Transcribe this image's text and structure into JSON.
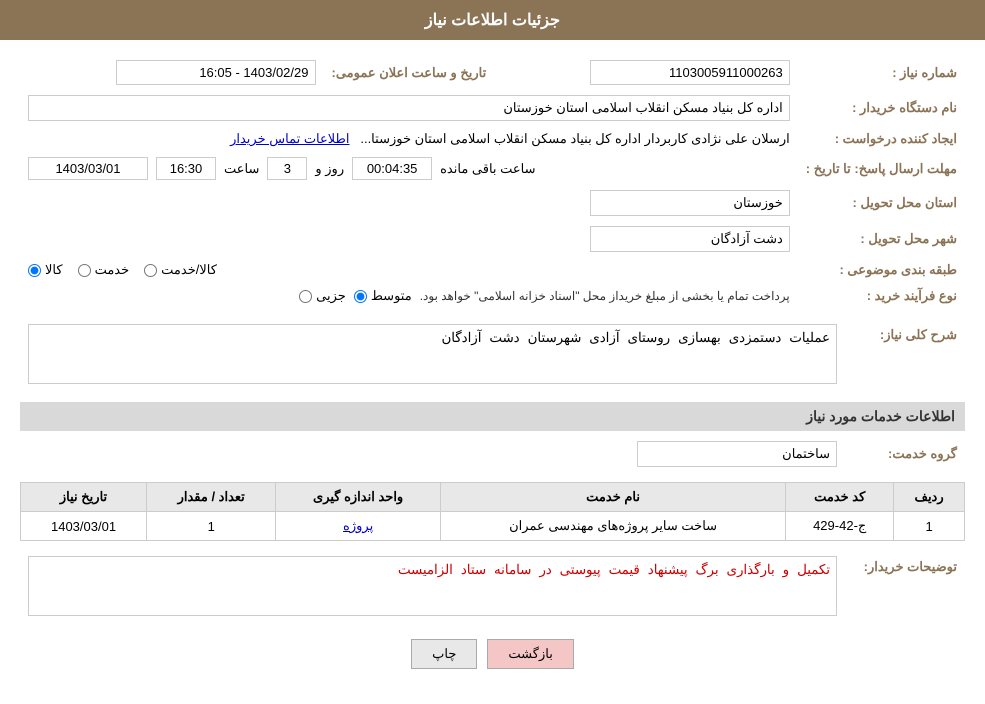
{
  "header": {
    "title": "جزئیات اطلاعات نیاز"
  },
  "fields": {
    "shomara_niaz_label": "شماره نیاز :",
    "shomara_niaz_value": "1103005911000263",
    "nam_dastgah_label": "نام دستگاه خریدار :",
    "nam_dastgah_value": "اداره کل بنیاد مسکن انقلاب اسلامی استان خوزستان",
    "ijad_label": "ایجاد کننده درخواست :",
    "ijad_value": "ارسلان علی نژادی کاربردار اداره کل بنیاد مسکن انقلاب اسلامی استان خوزستا...",
    "ijad_link": "اطلاعات تماس خریدار",
    "mohlat_label": "مهلت ارسال پاسخ: تا تاریخ :",
    "tarikh_label": "تاریخ و ساعت اعلان عمومی:",
    "tarikh_value": "1403/02/29 - 16:05",
    "date_value": "1403/03/01",
    "time_value": "16:30",
    "roz_value": "3",
    "countdown_value": "00:04:35",
    "ostan_label": "استان محل تحویل :",
    "ostan_value": "خوزستان",
    "shahr_label": "شهر محل تحویل :",
    "shahr_value": "دشت آزادگان",
    "tabaqe_label": "طبقه بندی موضوعی :",
    "tabaqe_options": [
      {
        "label": "کالا",
        "checked": true
      },
      {
        "label": "خدمت",
        "checked": false
      },
      {
        "label": "کالا/خدمت",
        "checked": false
      }
    ],
    "noeParvand_label": "نوع فرآیند خرید :",
    "noeParvand_options": [
      {
        "label": "جزیی",
        "checked": false
      },
      {
        "label": "متوسط",
        "checked": true
      }
    ],
    "noeParvand_note": "پرداخت تمام یا بخشی از مبلغ خریداز محل \"اسناد خزانه اسلامی\" خواهد بود.",
    "sharh_label": "شرح کلی نیاز:",
    "sharh_value": "عملیات دستمزدی بهسازی روستای آزادی شهرستان دشت آزادگان",
    "khadamat_label": "اطلاعات خدمات مورد نیاز",
    "grouh_label": "گروه خدمت:",
    "grouh_value": "ساختمان",
    "table": {
      "headers": [
        "ردیف",
        "کد خدمت",
        "نام خدمت",
        "واحد اندازه گیری",
        "تعداد / مقدار",
        "تاریخ نیاز"
      ],
      "rows": [
        {
          "radif": "1",
          "kod": "ج-42-429",
          "nam": "ساخت سایر پروژه‌های مهندسی عمران",
          "vahed": "پروژه",
          "tedad": "1",
          "tarikh": "1403/03/01"
        }
      ]
    },
    "tosihaat_label": "توضیحات خریدار:",
    "tosihaat_value": "تکمیل و بارگذاری برگ پیشنهاد قیمت پیوستی در سامانه ستاد الزامیست",
    "btn_chap": "چاپ",
    "btn_bazgasht": "بازگشت"
  }
}
